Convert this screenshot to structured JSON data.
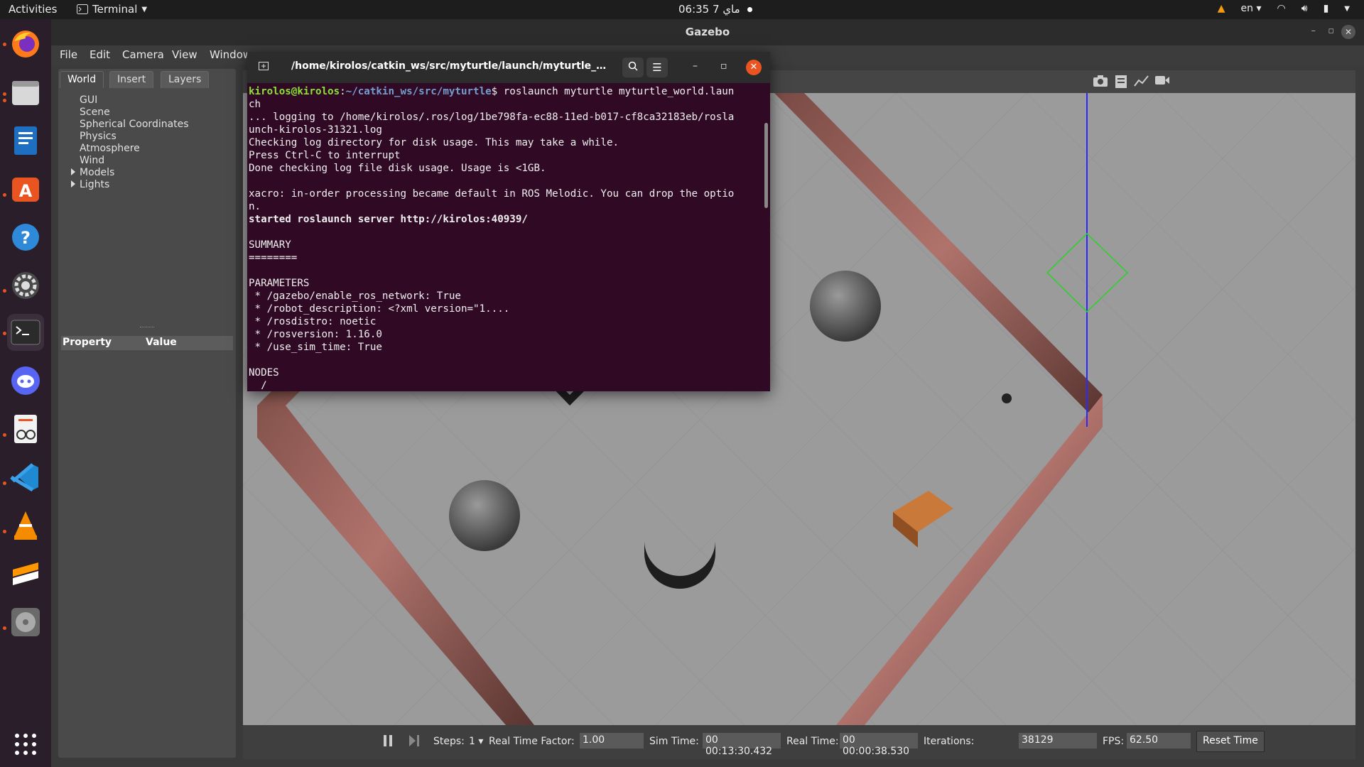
{
  "topbar": {
    "activities": "Activities",
    "app_menu": "Terminal",
    "clock": "06:35  7 ماي",
    "language": "en"
  },
  "dock": {
    "items": [
      "firefox-icon",
      "files-icon",
      "writer-icon",
      "software-icon",
      "help-icon",
      "settings-icon",
      "terminal-icon",
      "discord-icon",
      "document-viewer-icon",
      "vscode-icon",
      "vlc-icon",
      "sublime-icon",
      "disc-icon",
      "apps-grid-icon"
    ]
  },
  "gazebo": {
    "title": "Gazebo",
    "menu": [
      "File",
      "Edit",
      "Camera",
      "View",
      "Window"
    ],
    "tabs": [
      "World",
      "Insert",
      "Layers"
    ],
    "tree": [
      "GUI",
      "Scene",
      "Spherical Coordinates",
      "Physics",
      "Atmosphere",
      "Wind",
      "Models",
      "Lights"
    ],
    "property_header": "Property",
    "value_header": "Value",
    "bottom": {
      "steps_label": "Steps:",
      "steps_value": "1",
      "rtf_label": "Real Time Factor:",
      "rtf_value": "1.00",
      "sim_time_label": "Sim Time:",
      "sim_time_value": "00 00:13:30.432",
      "real_time_label": "Real Time:",
      "real_time_value": "00 00:00:38.530",
      "iterations_label": "Iterations:",
      "iterations_value": "38129",
      "fps_label": "FPS:",
      "fps_value": "62.50",
      "reset_label": "Reset Time"
    }
  },
  "terminal": {
    "title": "/home/kirolos/catkin_ws/src/myturtle/launch/myturtle_wor...",
    "prompt_user": "kirolos@kirolos",
    "prompt_path": "~/catkin_ws/src/myturtle",
    "command": "$ roslaunch myturtle myturtle_world.laun",
    "lines": [
      "ch",
      "... logging to /home/kirolos/.ros/log/1be798fa-ec88-11ed-b017-cf8ca32183eb/rosla",
      "unch-kirolos-31321.log",
      "Checking log directory for disk usage. This may take a while.",
      "Press Ctrl-C to interrupt",
      "Done checking log file disk usage. Usage is <1GB.",
      "",
      "xacro: in-order processing became default in ROS Melodic. You can drop the optio",
      "n."
    ],
    "server_line": "started roslaunch server http://kirolos:40939/",
    "lines2": [
      "",
      "SUMMARY",
      "========",
      "",
      "PARAMETERS",
      " * /gazebo/enable_ros_network: True",
      " * /robot_description: <?xml version=\"1....",
      " * /rosdistro: noetic",
      " * /rosversion: 1.16.0",
      " * /use_sim_time: True",
      "",
      "NODES",
      "  /"
    ]
  }
}
